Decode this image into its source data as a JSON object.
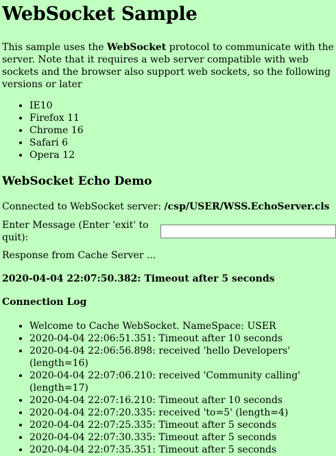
{
  "page": {
    "title": "WebSocket Sample",
    "intro_prefix": "This sample uses the ",
    "intro_bold": "WebSocket",
    "intro_suffix": " protocol to communicate with the server. Note that it requires a web server compatible with web sockets and the browser also support web sockets, so the following versions or later",
    "browsers": [
      "IE10",
      "Firefox 11",
      "Chrome 16",
      "Safari 6",
      "Opera 12"
    ]
  },
  "demo": {
    "heading": "WebSocket Echo Demo",
    "connected_label": "Connected to WebSocket server: ",
    "server_path": "/csp/USER/WSS.EchoServer.cls",
    "message_label": "Enter Message (Enter 'exit' to quit):",
    "message_value": "",
    "response_label": "Response from Cache Server ...",
    "status_text": "2020-04-04 22:07:50.382: Timeout after 5 seconds"
  },
  "log": {
    "heading": "Connection Log",
    "entries": [
      "Welcome to Cache WebSocket. NameSpace: USER",
      "2020-04-04 22:06:51.351: Timeout after 10 seconds",
      "2020-04-04 22:06:56.898: received 'hello Developers' (length=16)",
      "2020-04-04 22:07:06.210: received 'Community calling' (length=17)",
      "2020-04-04 22:07:16.210: Timeout after 10 seconds",
      "2020-04-04 22:07:20.335: received 'to=5' (length=4)",
      "2020-04-04 22:07:25.335: Timeout after 5 seconds",
      "2020-04-04 22:07:30.335: Timeout after 5 seconds",
      "2020-04-04 22:07:35.351: Timeout after 5 seconds"
    ]
  }
}
